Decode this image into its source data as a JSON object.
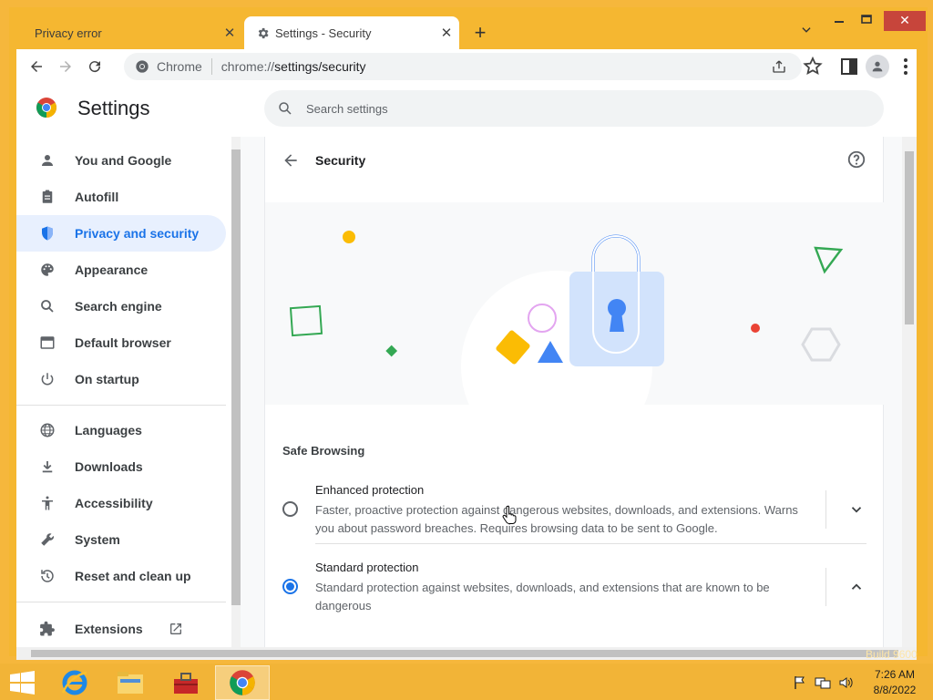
{
  "tabs": [
    {
      "label": "Privacy error",
      "close": "✕"
    },
    {
      "label": "Settings - Security",
      "close": "✕"
    }
  ],
  "new_tab": "+",
  "window_controls": {
    "minimize": "▬",
    "maximize": "☐",
    "close": "✕"
  },
  "omnibox": {
    "scheme_label": "Chrome",
    "url_prefix": "chrome://",
    "url_path": "settings/security"
  },
  "header": {
    "title": "Settings",
    "search_placeholder": "Search settings"
  },
  "sidebar": {
    "items": [
      {
        "label": "You and Google",
        "icon": "person-icon"
      },
      {
        "label": "Autofill",
        "icon": "clipboard-icon"
      },
      {
        "label": "Privacy and security",
        "icon": "shield-icon",
        "selected": true
      },
      {
        "label": "Appearance",
        "icon": "palette-icon"
      },
      {
        "label": "Search engine",
        "icon": "search-icon"
      },
      {
        "label": "Default browser",
        "icon": "browser-icon"
      },
      {
        "label": "On startup",
        "icon": "power-icon"
      },
      {
        "label": "Languages",
        "icon": "globe-icon"
      },
      {
        "label": "Downloads",
        "icon": "download-icon"
      },
      {
        "label": "Accessibility",
        "icon": "accessibility-icon"
      },
      {
        "label": "System",
        "icon": "wrench-icon"
      },
      {
        "label": "Reset and clean up",
        "icon": "restore-icon"
      },
      {
        "label": "Extensions",
        "icon": "puzzle-icon"
      }
    ]
  },
  "security": {
    "title": "Security",
    "safe_browsing_heading": "Safe Browsing",
    "options": [
      {
        "title": "Enhanced protection",
        "description": "Faster, proactive protection against dangerous websites, downloads, and extensions. Warns you about password breaches. Requires browsing data to be sent to Google.",
        "checked": false,
        "expanded": false
      },
      {
        "title": "Standard protection",
        "description": "Standard protection against websites, downloads, and extensions that are known to be dangerous",
        "checked": true,
        "expanded": true
      }
    ]
  },
  "taskbar": {
    "apps": [
      "internet-explorer",
      "file-explorer",
      "toolbox",
      "chrome"
    ],
    "clock_time": "7:26 AM",
    "clock_date": "8/8/2022"
  },
  "watermark": "Build 9600",
  "colors": {
    "accent": "#1a73e8",
    "frame": "#f5b731",
    "selected_bg": "#e8f0fe"
  }
}
